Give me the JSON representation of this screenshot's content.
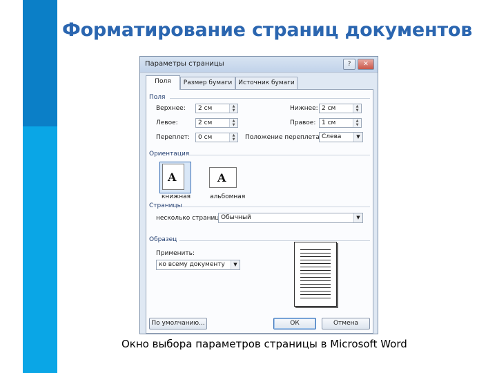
{
  "slide": {
    "title": "Форматирование страниц документов",
    "caption": "Окно выбора параметров страницы в Microsoft Word",
    "colors": {
      "accent_dark": "#0b7fc7",
      "accent_light": "#0aa6e6",
      "title": "#2b66b0"
    }
  },
  "dialog": {
    "title": "Параметры страницы",
    "help_icon": "question-icon",
    "close_icon": "close-icon",
    "tabs": [
      "Поля",
      "Размер бумаги",
      "Источник бумаги"
    ],
    "active_tab": "Поля",
    "margins": {
      "group": "Поля",
      "top_label": "Верхнее:",
      "top_value": "2 см",
      "bottom_label": "Нижнее:",
      "bottom_value": "2 см",
      "left_label": "Левое:",
      "left_value": "2 см",
      "right_label": "Правое:",
      "right_value": "1 см",
      "gutter_label": "Переплет:",
      "gutter_value": "0 см",
      "gutter_pos_label": "Положение переплета:",
      "gutter_pos_value": "Слева"
    },
    "orientation": {
      "group": "Ориентация",
      "portrait_label": "книжная",
      "landscape_label": "альбомная",
      "icon_letter": "A",
      "selected": "книжная"
    },
    "pages": {
      "group": "Страницы",
      "multiple_label": "несколько страниц:",
      "multiple_value": "Обычный"
    },
    "preview": {
      "group": "Образец",
      "apply_label": "Применить:",
      "apply_value": "ко всему документу"
    },
    "buttons": {
      "default": "По умолчанию...",
      "ok": "ОК",
      "cancel": "Отмена"
    }
  }
}
